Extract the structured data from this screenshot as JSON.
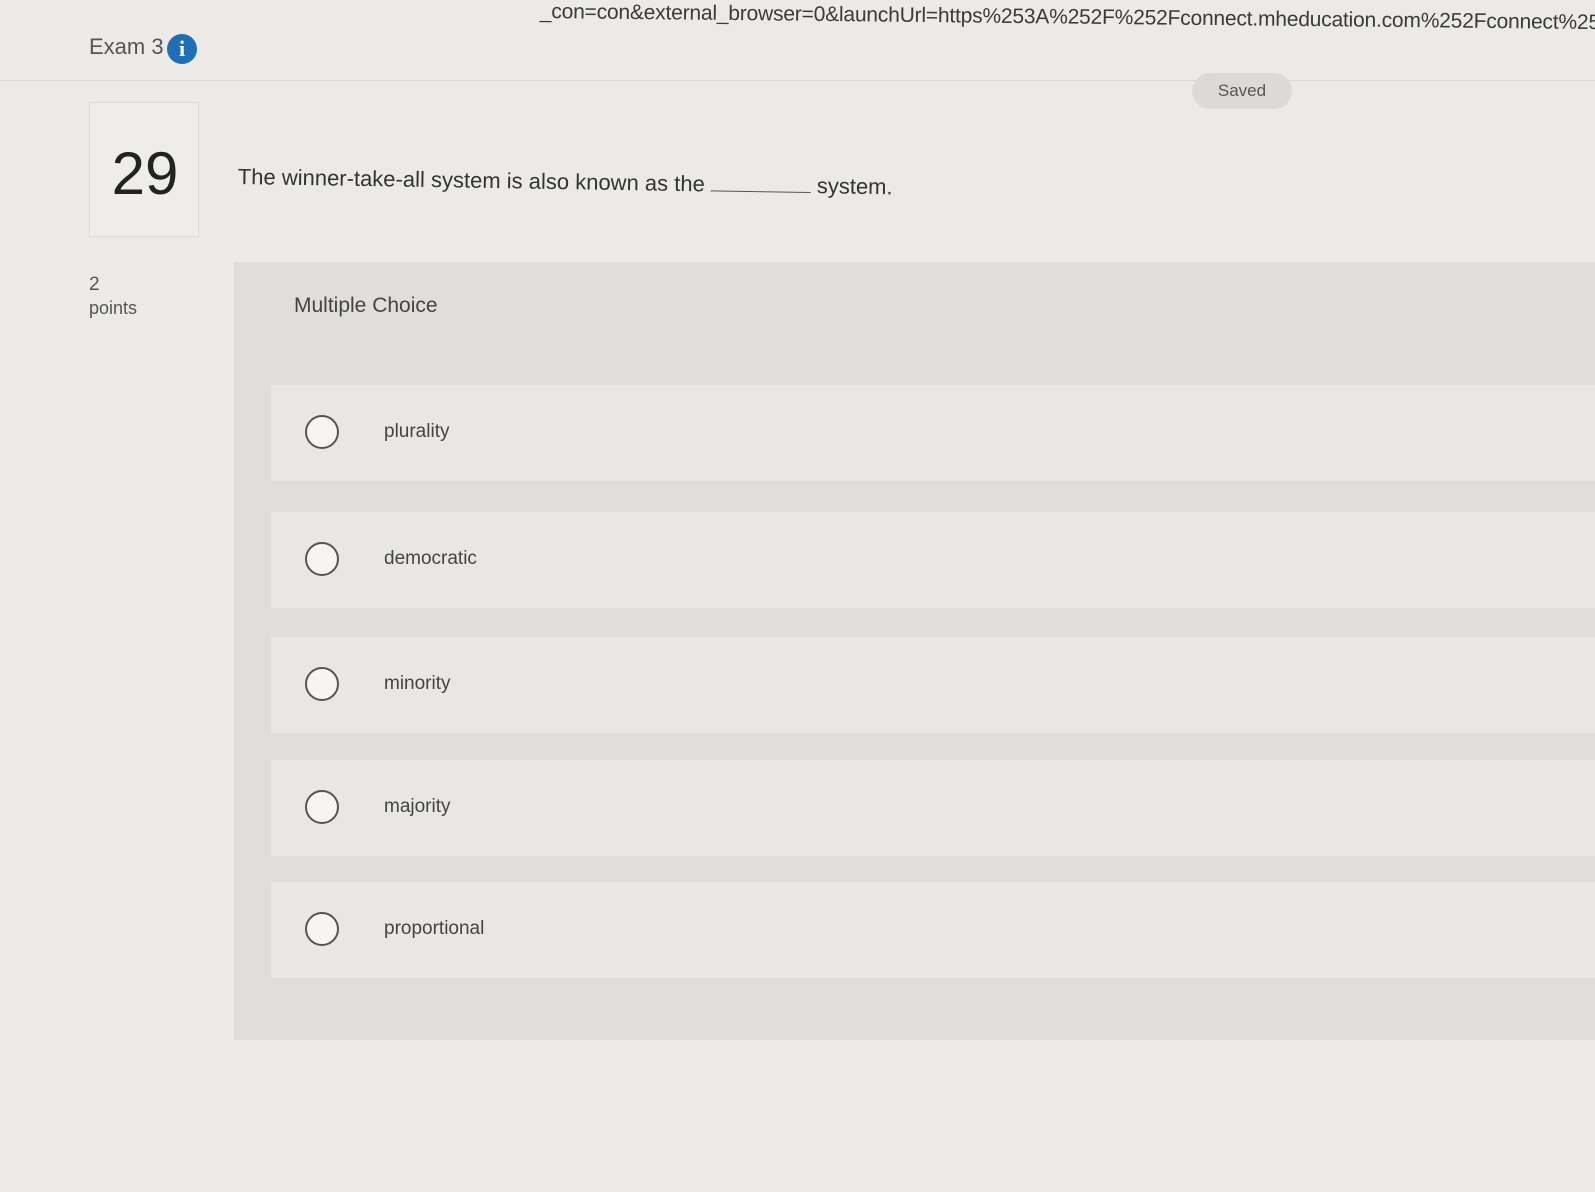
{
  "browser": {
    "url_fragment": "_con=con&external_browser=0&launchUrl=https%253A%252F%252Fconnect.mheducation.com%252Fconnect%252"
  },
  "header": {
    "exam_title": "Exam 3",
    "info_icon": "info-icon",
    "save_status": "Saved"
  },
  "question": {
    "number": "29",
    "points_value": "2",
    "points_label": "points",
    "text_before_blank": "The winner-take-all system is also known as the",
    "text_after_blank": "system."
  },
  "answer_panel": {
    "type_label": "Multiple Choice",
    "choices": [
      {
        "label": "plurality",
        "selected": false
      },
      {
        "label": "democratic",
        "selected": false
      },
      {
        "label": "minority",
        "selected": false
      },
      {
        "label": "majority",
        "selected": false
      },
      {
        "label": "proportional",
        "selected": false
      }
    ]
  }
}
